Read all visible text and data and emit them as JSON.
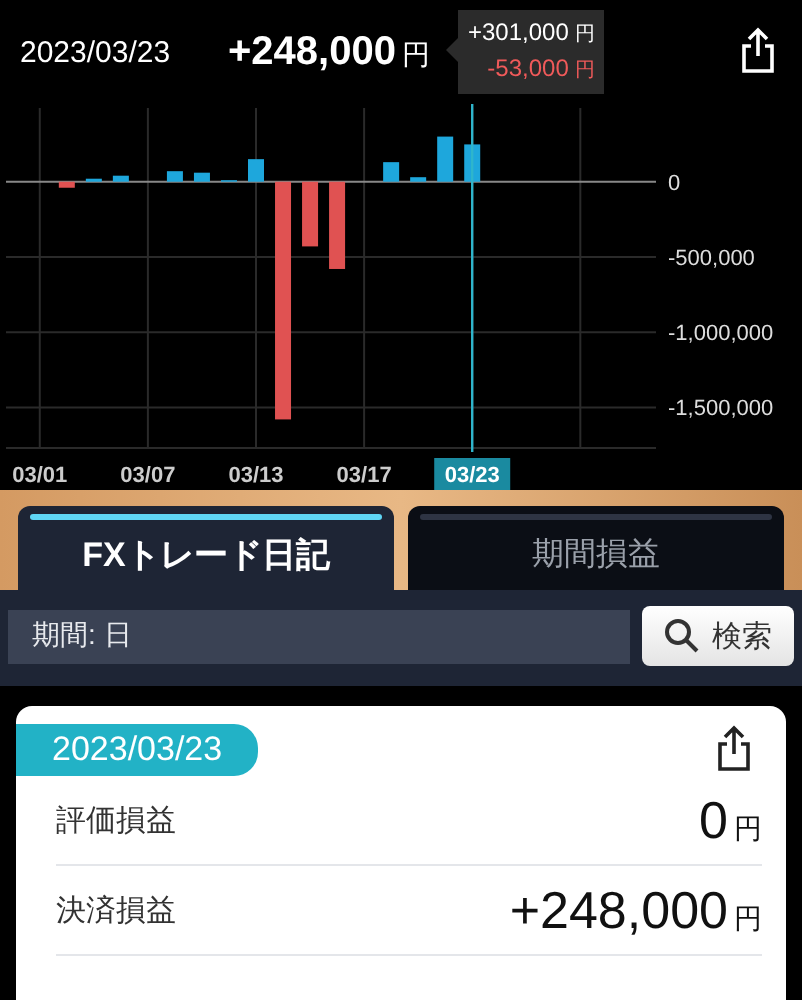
{
  "header": {
    "date": "2023/03/23",
    "total": "+248,000",
    "total_unit": "円",
    "breakdown": [
      {
        "kind": "gain",
        "amount": "+301,000",
        "unit": "円"
      },
      {
        "kind": "loss",
        "amount": "-53,000",
        "unit": "円"
      }
    ]
  },
  "chart": {
    "chart_data": {
      "type": "bar",
      "categories": [
        "03/01",
        null,
        null,
        null,
        "03/07",
        null,
        null,
        null,
        "03/13",
        null,
        null,
        null,
        "03/17",
        null,
        null,
        null,
        "03/23",
        null,
        null,
        null,
        null
      ],
      "grid": true,
      "series": [
        {
          "color": "#1ea7dc",
          "values": [
            null,
            null,
            20000,
            40000,
            null,
            70000,
            60000,
            10000,
            150000,
            null,
            null,
            null,
            null,
            130000,
            30000,
            300000,
            248000,
            null,
            null,
            null,
            null
          ]
        },
        {
          "color": "#e05252",
          "values": [
            null,
            -40000,
            null,
            null,
            null,
            null,
            null,
            null,
            null,
            -1580000,
            -430000,
            -580000,
            null,
            null,
            null,
            null,
            null,
            null,
            null,
            null,
            null
          ]
        }
      ],
      "stacked": true,
      "ylim": [
        -1770000,
        490000
      ],
      "yticks": [
        {
          "value": 0,
          "label": "0"
        },
        {
          "value": -500000,
          "label": "-500,000"
        },
        {
          "value": -1000000,
          "label": "-1,000,000"
        },
        {
          "value": -1500000,
          "label": "-1,500,000"
        }
      ],
      "annotations": [
        {
          "x": "03/23"
        }
      ]
    }
  },
  "tabs": [
    {
      "label": "FXトレード日記",
      "selected": true
    },
    {
      "label": "期間損益",
      "selected": false
    }
  ],
  "search": {
    "value": "期間: 日",
    "button": "検索"
  },
  "card": {
    "date": "2023/03/23",
    "rows": [
      {
        "label": "評価損益",
        "value": "0",
        "unit": "円"
      },
      {
        "label": "決済損益",
        "value": "+248,000",
        "unit": "円"
      }
    ]
  }
}
